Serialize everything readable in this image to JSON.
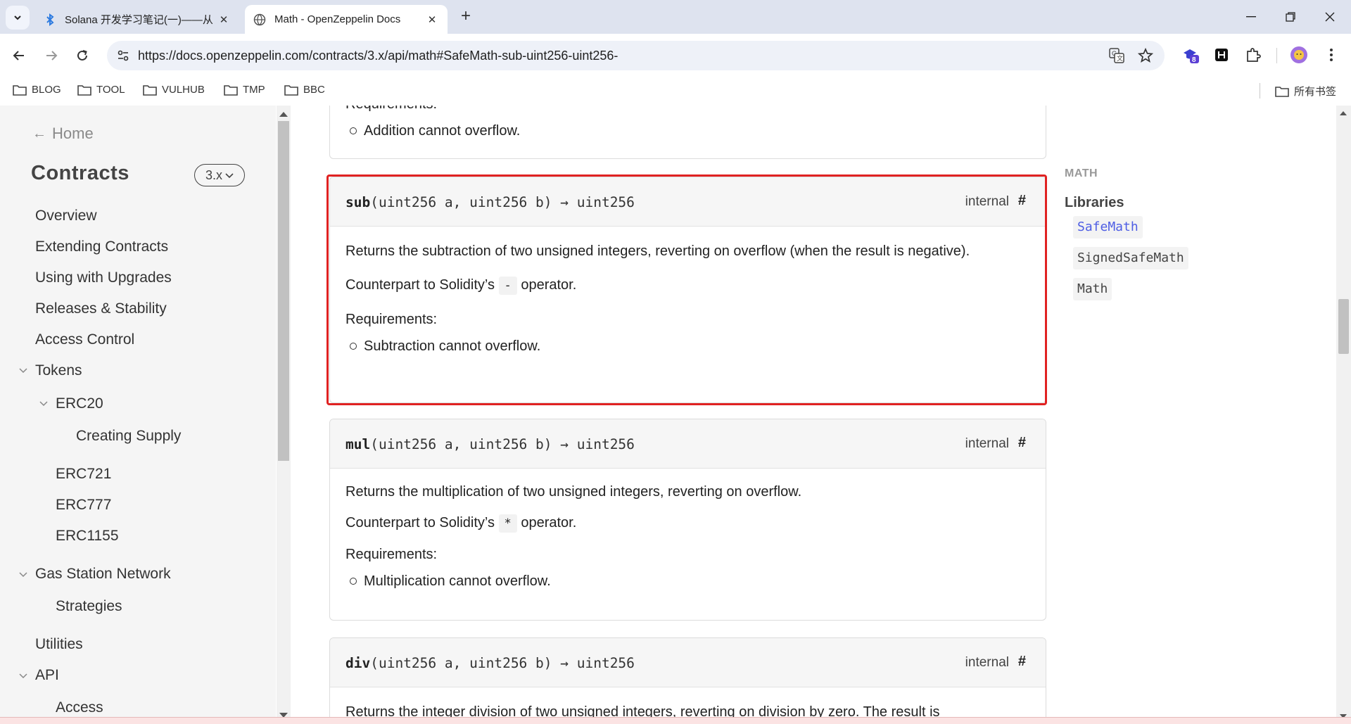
{
  "browser": {
    "tabs": [
      {
        "title": "Solana 开发学习笔记(一)——从",
        "active": false
      },
      {
        "title": "Math - OpenZeppelin Docs",
        "active": true
      }
    ],
    "url": "https://docs.openzeppelin.com/contracts/3.x/api/math#SafeMath-sub-uint256-uint256-",
    "extension_badge": "8",
    "bookmarks": [
      "BLOG",
      "TOOL",
      "VULHUB",
      "TMP",
      "BBC"
    ],
    "all_bookmarks_label": "所有书签"
  },
  "sidebar": {
    "home_label": "Home",
    "product_title": "Contracts",
    "version": "3.x",
    "items": [
      {
        "label": "Overview"
      },
      {
        "label": "Extending Contracts"
      },
      {
        "label": "Using with Upgrades"
      },
      {
        "label": "Releases & Stability"
      },
      {
        "label": "Access Control"
      },
      {
        "label": "Tokens"
      },
      {
        "label": "ERC20"
      },
      {
        "label": "Creating Supply"
      },
      {
        "label": "ERC721"
      },
      {
        "label": "ERC777"
      },
      {
        "label": "ERC1155"
      },
      {
        "label": "Gas Station Network"
      },
      {
        "label": "Strategies"
      },
      {
        "label": "Utilities"
      },
      {
        "label": "API"
      },
      {
        "label": "Access"
      }
    ]
  },
  "content": {
    "prev_card": {
      "partial_heading": "Requirements:",
      "requirement": "Addition cannot overflow."
    },
    "sub": {
      "fn": "sub",
      "params": "(uint256 a, uint256 b) → uint256",
      "visibility": "internal",
      "anchor": "#",
      "description": "Returns the subtraction of two unsigned integers, reverting on overflow (when the result is negative).",
      "counterpart_prefix": "Counterpart to Solidity’s",
      "operator": "-",
      "counterpart_suffix": "operator.",
      "requirements_label": "Requirements:",
      "requirement": "Subtraction cannot overflow."
    },
    "mul": {
      "fn": "mul",
      "params": "(uint256 a, uint256 b) → uint256",
      "visibility": "internal",
      "anchor": "#",
      "description": "Returns the multiplication of two unsigned integers, reverting on overflow.",
      "counterpart_prefix": "Counterpart to Solidity’s",
      "operator": "*",
      "counterpart_suffix": "operator.",
      "requirements_label": "Requirements:",
      "requirement": "Multiplication cannot overflow."
    },
    "div": {
      "fn": "div",
      "params": "(uint256 a, uint256 b) → uint256",
      "visibility": "internal",
      "anchor": "#",
      "description_partial": "Returns the integer division of two unsigned integers, reverting on division by zero. The result is"
    }
  },
  "toc": {
    "section_label": "MATH",
    "heading": "Libraries",
    "items": [
      {
        "label": "SafeMath",
        "active": true
      },
      {
        "label": "SignedSafeMath",
        "active": false
      },
      {
        "label": "Math",
        "active": false
      }
    ]
  },
  "colors": {
    "highlight_border": "#e02222",
    "toc_active": "#4e5ee4",
    "tabbar_bg": "#dee3ef"
  }
}
